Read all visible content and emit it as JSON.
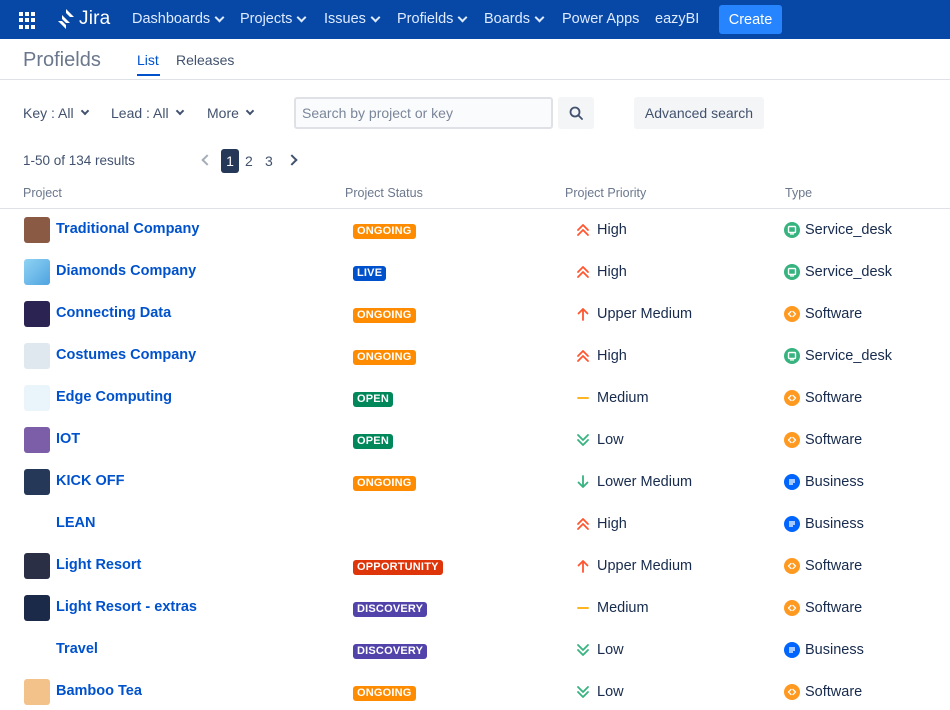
{
  "nav": {
    "logo_text": "Jira",
    "items": [
      "Dashboards",
      "Projects",
      "Issues",
      "Profields",
      "Boards",
      "Power Apps",
      "eazyBI"
    ],
    "create_label": "Create"
  },
  "page": {
    "title": "Profields",
    "tabs": [
      "List",
      "Releases"
    ],
    "active_tab": "List"
  },
  "filters": {
    "key": "Key : All",
    "lead": "Lead : All",
    "more": "More",
    "search_placeholder": "Search by project or key",
    "advanced_search": "Advanced search"
  },
  "pagination": {
    "summary": "1-50 of 134 results",
    "pages": [
      "1",
      "2",
      "3"
    ],
    "current": "1"
  },
  "table": {
    "headers": [
      "Project",
      "Project Status",
      "Project Priority",
      "Type"
    ],
    "rows": [
      {
        "name": "Traditional Company",
        "status": "ONGOING",
        "priority": "High",
        "type": "Service_desk"
      },
      {
        "name": "Diamonds Company",
        "status": "LIVE",
        "priority": "High",
        "type": "Service_desk"
      },
      {
        "name": "Connecting Data",
        "status": "ONGOING",
        "priority": "Upper Medium",
        "type": "Software"
      },
      {
        "name": "Costumes Company",
        "status": "ONGOING",
        "priority": "High",
        "type": "Service_desk"
      },
      {
        "name": "Edge Computing",
        "status": "OPEN",
        "priority": "Medium",
        "type": "Software"
      },
      {
        "name": "IOT",
        "status": "OPEN",
        "priority": "Low",
        "type": "Software"
      },
      {
        "name": "KICK OFF",
        "status": "ONGOING",
        "priority": "Lower Medium",
        "type": "Business"
      },
      {
        "name": "LEAN",
        "status": "",
        "priority": "High",
        "type": "Business"
      },
      {
        "name": "Light Resort",
        "status": "OPPORTUNITY",
        "priority": "Upper Medium",
        "type": "Software"
      },
      {
        "name": "Light Resort - extras",
        "status": "DISCOVERY",
        "priority": "Medium",
        "type": "Software"
      },
      {
        "name": "Travel",
        "status": "DISCOVERY",
        "priority": "Low",
        "type": "Business"
      },
      {
        "name": "Bamboo Tea",
        "status": "ONGOING",
        "priority": "Low",
        "type": "Software"
      }
    ]
  },
  "colors": {
    "nav_bg": "#0747a6",
    "create_bg": "#2684ff",
    "link": "#0052cc",
    "status_ongoing": "#ff8b00",
    "status_live": "#0052cc",
    "status_open": "#00875a",
    "status_opportunity": "#de350b",
    "status_discovery": "#5243aa",
    "type_service_desk": "#36b37e",
    "type_software": "#ff991f",
    "type_business": "#0065ff"
  }
}
